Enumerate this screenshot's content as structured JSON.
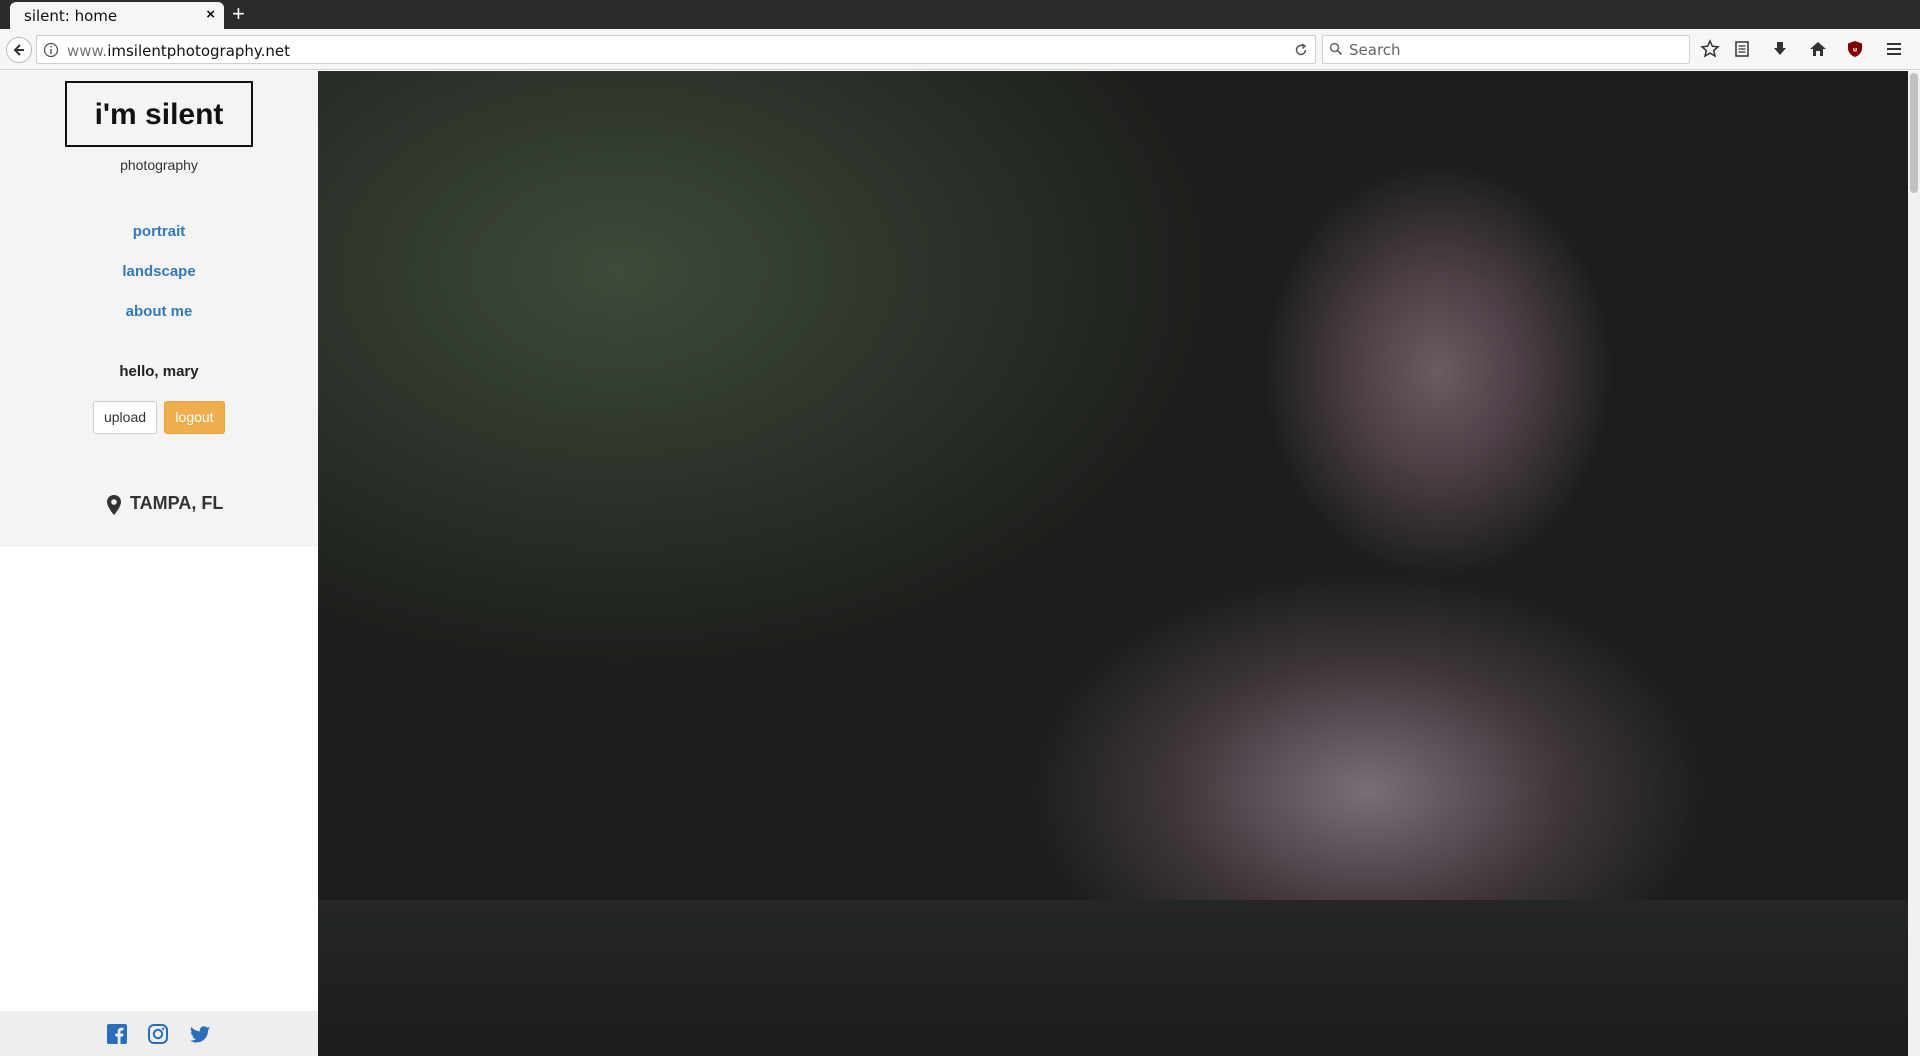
{
  "browser": {
    "tab_title": "silent: home",
    "url_prefix": "www.",
    "url_domain": "imsilentphotography.net",
    "search_placeholder": "Search"
  },
  "sidebar": {
    "logo_title": "i'm silent",
    "logo_subtitle": "photography",
    "nav": [
      {
        "label": "portrait"
      },
      {
        "label": "landscape"
      },
      {
        "label": "about me"
      }
    ],
    "greeting": "hello, mary",
    "upload_label": "upload",
    "logout_label": "logout",
    "location": "TAMPA, FL"
  },
  "social_icons": [
    "facebook-icon",
    "instagram-icon",
    "twitter-icon"
  ],
  "colors": {
    "link": "#337ab7",
    "logout": "#f0ad4e",
    "social": "#2a6ebb"
  }
}
